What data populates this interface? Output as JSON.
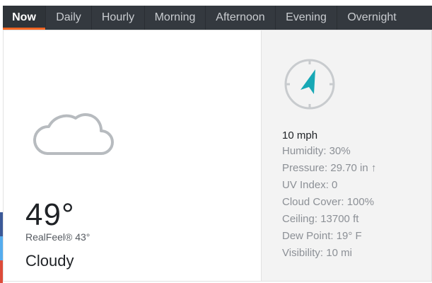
{
  "tabs": [
    {
      "label": "Now",
      "active": true
    },
    {
      "label": "Daily",
      "active": false
    },
    {
      "label": "Hourly",
      "active": false
    },
    {
      "label": "Morning",
      "active": false
    },
    {
      "label": "Afternoon",
      "active": false
    },
    {
      "label": "Evening",
      "active": false
    },
    {
      "label": "Overnight",
      "active": false
    }
  ],
  "current": {
    "icon": "cloud-icon",
    "temperature": "49°",
    "realfeel": "RealFeel® 43°",
    "phrase": "Cloudy"
  },
  "details": {
    "compass_icon": "compass-icon",
    "wind": "10 mph",
    "humidity": "Humidity: 30%",
    "pressure": "Pressure: 29.70 in ↑",
    "uv_index": "UV Index: 0",
    "cloud_cover": "Cloud Cover: 100%",
    "ceiling": "Ceiling: 13700 ft",
    "dew_point": "Dew Point: 19° F",
    "visibility": "Visibility: 10 mi"
  },
  "colors": {
    "tab_bar": "#34393f",
    "active_underline": "#f26522",
    "compass_arrow": "#17a8b5",
    "side_blue": "#3b5998",
    "side_cyan": "#55acee",
    "side_red": "#dd4b39"
  }
}
